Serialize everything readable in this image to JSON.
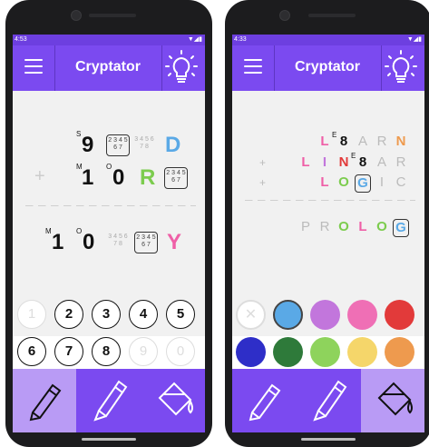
{
  "left_screen": {
    "status": {
      "time": "4:53",
      "signal": "▼◢▮"
    },
    "app_title": "Cryptator",
    "puzzle": {
      "row1": {
        "d1": {
          "sup": "S",
          "value": "9"
        },
        "d2_candidates": "2 3 4 5\n6 7",
        "d3_candidates": "3 4 5 6\n7 8",
        "d4": "D"
      },
      "operator": "+",
      "row2": {
        "d1": {
          "sup": "M",
          "value": "1"
        },
        "d2": {
          "sup": "O",
          "value": "0"
        },
        "d3": "R",
        "d4_candidates": "2 3 4 5\n6 7"
      },
      "result": {
        "d1": {
          "sup": "M",
          "value": "1"
        },
        "d2": {
          "sup": "O",
          "value": "0"
        },
        "d3_candidates": "3 4 5 6\n7 8",
        "d4_candidates": "2 3 4 5\n6 7",
        "d5": "Y"
      }
    },
    "keypad": {
      "row1": [
        "1",
        "2",
        "3",
        "4",
        "5"
      ],
      "row2": [
        "6",
        "7",
        "8",
        "9",
        "0"
      ]
    },
    "colors": {
      "D": "#5aa9e6",
      "R": "#7ccc4e",
      "Y": "#ef5fa7"
    }
  },
  "right_screen": {
    "status": {
      "time": "4:33",
      "signal": "▼◢▮"
    },
    "app_title": "Cryptator",
    "puzzle": {
      "row1": {
        "letters": [
          "L",
          "8",
          "A",
          "R",
          "N"
        ],
        "sup": "E"
      },
      "operator1": "+",
      "row2": {
        "letters": [
          "L",
          "I",
          "N",
          "8",
          "A",
          "R"
        ],
        "sup": "E"
      },
      "operator2": "+",
      "row3": {
        "letters": [
          "L",
          "O",
          "G",
          "I",
          "C"
        ]
      },
      "result": {
        "letters": [
          "P",
          "R",
          "O",
          "L",
          "O",
          "G"
        ]
      }
    },
    "palette": {
      "row1": [
        "clear",
        "#5aa9e6",
        "#c276dc",
        "#ef6fb5",
        "#e23a3a"
      ],
      "row2": [
        "#2e2ec8",
        "#2e7a3a",
        "#8ed35c",
        "#f5d66a",
        "#ee9a4e"
      ],
      "clear_label": "✕"
    }
  },
  "toolbar": {
    "tools": [
      "pencil",
      "pen",
      "paint-bucket"
    ]
  }
}
